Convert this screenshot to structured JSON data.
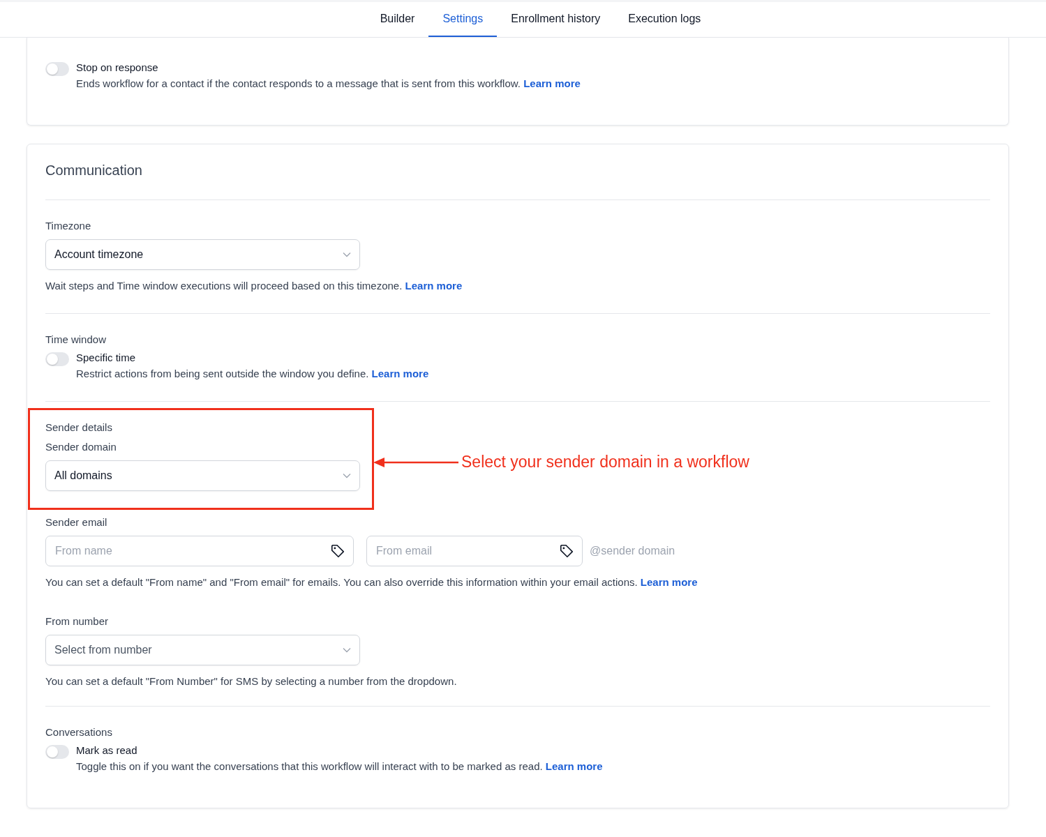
{
  "tabs": [
    {
      "label": "Builder",
      "selected": false
    },
    {
      "label": "Settings",
      "selected": true
    },
    {
      "label": "Enrollment history",
      "selected": false
    },
    {
      "label": "Execution logs",
      "selected": false
    }
  ],
  "stop_on_response": {
    "label": "Stop on response",
    "on": false,
    "description": "Ends workflow for a contact if the contact responds to a message that is sent from this workflow.",
    "link": "Learn more"
  },
  "communication": {
    "title": "Communication",
    "timezone": {
      "label": "Timezone",
      "value": "Account timezone",
      "help": "Wait steps and Time window executions will proceed based on this timezone.",
      "link": "Learn more"
    },
    "time_window": {
      "label": "Time window",
      "toggle": {
        "label": "Specific time",
        "on": false,
        "description": "Restrict actions from being sent outside the window you define.",
        "link": "Learn more"
      }
    },
    "sender_details": {
      "label": "Sender details",
      "domain_label": "Sender domain",
      "domain_value": "All domains"
    },
    "sender_email": {
      "label": "Sender email",
      "from_name": {
        "placeholder": "From name"
      },
      "from_email": {
        "placeholder": "From email"
      },
      "suffix": "@sender domain",
      "help": "You can set a default \"From name\" and \"From email\" for emails. You can also override this information within your email actions.",
      "link": "Learn more"
    },
    "from_number": {
      "label": "From number",
      "placeholder": "Select from number",
      "help": "You can set a default \"From Number\" for SMS by selecting a number from the dropdown."
    },
    "conversations": {
      "label": "Conversations",
      "toggle": {
        "label": "Mark as read",
        "on": false,
        "description": "Toggle this on if you want the conversations that this workflow will interact with to be marked as read.",
        "link": "Learn more"
      }
    }
  },
  "annotation": {
    "text": "Select your sender domain in a workflow"
  }
}
